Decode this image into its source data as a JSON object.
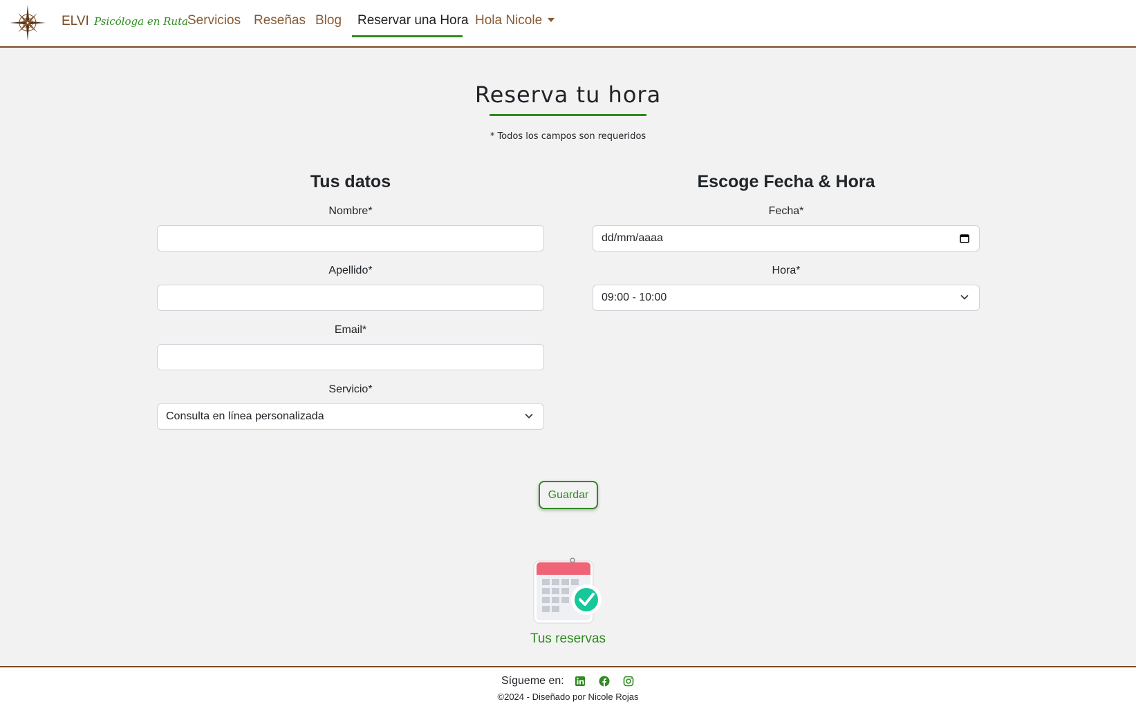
{
  "nav": {
    "brand": "ELVI",
    "brand_tagline": "Psicóloga en Ruta",
    "items": [
      {
        "label": "Servicios"
      },
      {
        "label": "Reseñas"
      },
      {
        "label": "Blog"
      },
      {
        "label": "Reservar una Hora"
      },
      {
        "label": "Hola Nicole"
      }
    ],
    "active_item": "Reservar una Hora"
  },
  "page": {
    "title": "Reserva tu hora",
    "required_note": "* Todos los campos son requeridos"
  },
  "personal": {
    "title": "Tus datos",
    "nombre_label": "Nombre*",
    "nombre_value": "",
    "apellido_label": "Apellido*",
    "apellido_value": "",
    "email_label": "Email*",
    "email_value": "",
    "servicio_label": "Servicio*",
    "servicio_value": "Consulta en línea personalizada"
  },
  "schedule": {
    "title": "Escoge Fecha & Hora",
    "fecha_label": "Fecha*",
    "fecha_placeholder": "dd/mm/aaaa",
    "hora_label": "Hora*",
    "hora_value": "09:00 - 10:00"
  },
  "actions": {
    "save_label": "Guardar"
  },
  "reservas": {
    "link_label": "Tus reservas",
    "icon": "calendar-check-icon"
  },
  "footer": {
    "follow_label": "Sígueme en:",
    "social": [
      "linkedin-icon",
      "facebook-icon",
      "instagram-icon"
    ],
    "copyright": "©2024 - Diseñado por Nicole Rojas"
  },
  "colors": {
    "brand_brown": "#7a4a26",
    "accent_green": "#2e8b1f",
    "background": "#f2f2f2"
  }
}
